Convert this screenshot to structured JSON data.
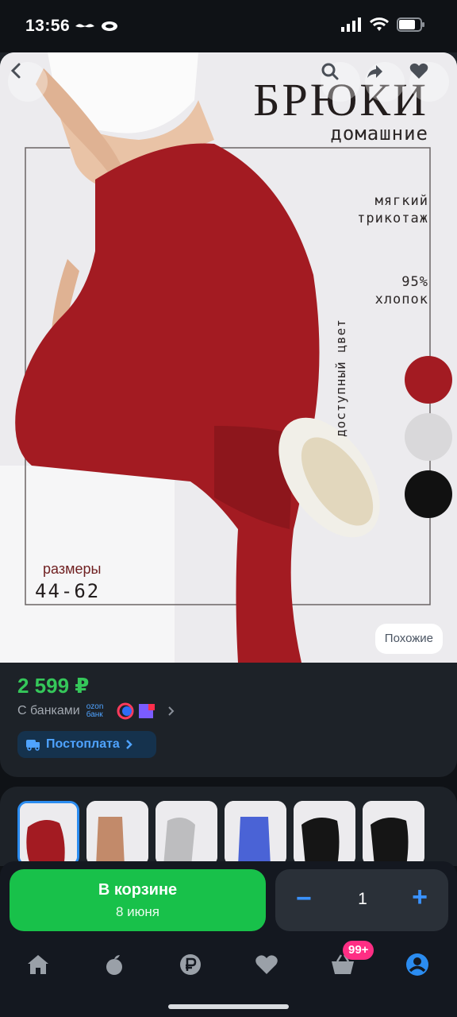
{
  "status_bar": {
    "time": "13:56",
    "left_icons": "mustache-icon, face-mask-icon"
  },
  "product_image": {
    "ad_title": "БРЮКИ",
    "ad_subtitle": "домашние",
    "soft_line1": "мягкий",
    "soft_line2": "трикотаж",
    "cotton_line1": "95%",
    "cotton_line2": "хлопок",
    "colors_label": "доступный цвет",
    "sizes_label": "размеры",
    "sizes_value": "44-62",
    "color_swatches": [
      "#a31b22",
      "#d9d8da",
      "#111111"
    ],
    "similar_button": "Похожие"
  },
  "price": "2 599 ₽",
  "banks": {
    "label": "С банками",
    "ozon_label": "ozon банк"
  },
  "postpay": {
    "label": "Постоплата"
  },
  "cart": {
    "button_label": "В корзине",
    "delivery_date": "8 июня",
    "quantity": "1"
  },
  "tabbar": {
    "badge": "99+"
  },
  "colors": {
    "accent_green": "#18c14a",
    "accent_blue": "#3a92ff",
    "badge_pink": "#ff2e84",
    "price_green": "#35c75a"
  }
}
